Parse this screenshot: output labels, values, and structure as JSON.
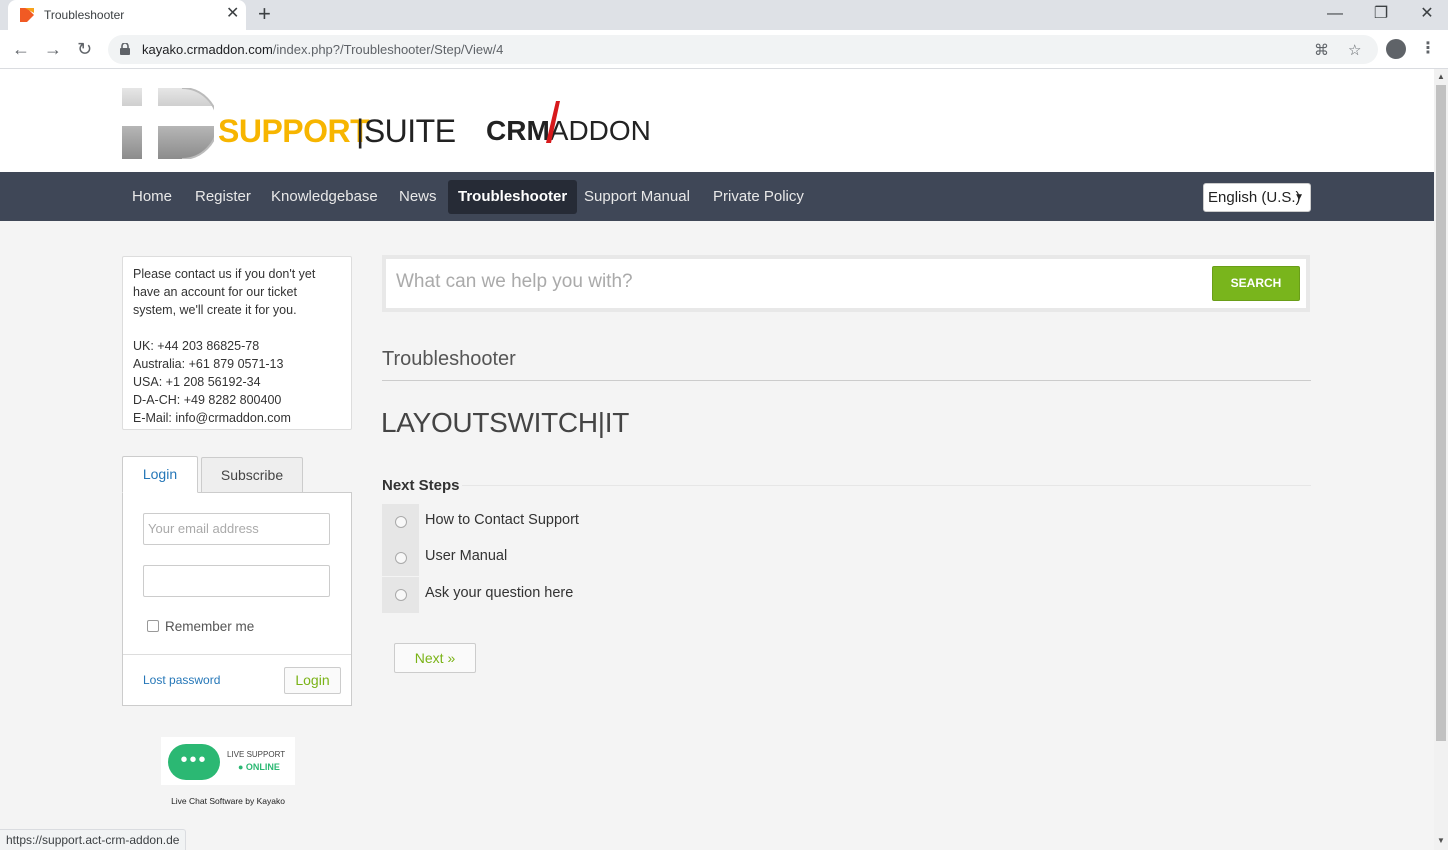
{
  "browser": {
    "tab_title": "Troubleshooter",
    "url_host": "kayako.crmaddon.com",
    "url_path": "/index.php?/Troubleshooter/Step/View/4",
    "status_url": "https://support.act-crm-addon.de"
  },
  "header": {
    "logo_support": "SUPPORT",
    "logo_suite": "|SUITE",
    "crm_logo_crm": "CRM",
    "crm_logo_addon": "ADDON"
  },
  "nav": {
    "items": [
      {
        "label": "Home"
      },
      {
        "label": "Register"
      },
      {
        "label": "Knowledgebase"
      },
      {
        "label": "News"
      },
      {
        "label": "Troubleshooter"
      },
      {
        "label": "Support Manual"
      },
      {
        "label": "Private Policy"
      }
    ],
    "language": "English (U.S.)",
    "active_index": 4
  },
  "sidebar": {
    "info_lines": [
      "Please contact us if you don't yet",
      "have an account for our ticket",
      "system, we'll create it for you.",
      "UK: +44 203 86825-78",
      "Australia: +61 879 0571-13",
      "USA: +1 208 56192-34",
      "D-A-CH: +49 8282 800400",
      "E-Mail: info@crmaddon.com"
    ],
    "tab_login": "Login",
    "tab_subscribe": "Subscribe",
    "email_placeholder": "Your email address",
    "remember_me": "Remember me",
    "lost_password": "Lost password",
    "login_button": "Login",
    "live_support": "LIVE SUPPORT",
    "online": "● ONLINE",
    "live_credit": "Live Chat Software by Kayako"
  },
  "main": {
    "search_placeholder": "What can we help you with?",
    "search_button": "SEARCH",
    "section_title": "Troubleshooter",
    "step_title": "LAYOUTSWITCH|IT",
    "next_steps_label": "Next Steps",
    "options": [
      {
        "label": "How to Contact Support"
      },
      {
        "label": "User Manual"
      },
      {
        "label": "Ask your question here"
      }
    ],
    "next_button": "Next »"
  },
  "colors": {
    "accent_green": "#79b51c",
    "nav_bg": "#3f4757",
    "link_blue": "#2577b8",
    "logo_yellow": "#f7b500"
  }
}
